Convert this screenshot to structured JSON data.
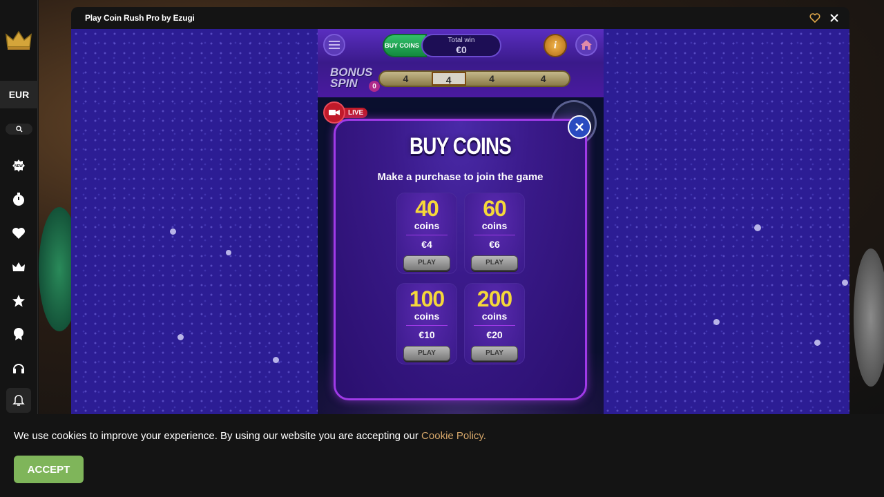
{
  "sidebar": {
    "currency": "EUR",
    "icons": [
      "new-icon",
      "clock-icon",
      "heart-icon",
      "crown-icon",
      "star-icon",
      "award-icon",
      "headset-icon",
      "bell-icon"
    ]
  },
  "game_window": {
    "title": "Play Coin Rush Pro by Ezugi"
  },
  "game": {
    "buy_coins_label": "BUY COINS",
    "total_win_label": "Total win",
    "total_win_value": "€0",
    "info_label": "i",
    "bonus_label": "BONUS SPIN",
    "bonus_count": "0",
    "bonus_cells": [
      "4",
      "4",
      "4",
      "4"
    ],
    "live_label": "LIVE"
  },
  "modal": {
    "title": "BUY COINS",
    "subtitle": "Make a purchase to join the game",
    "offers": [
      {
        "amount": "40",
        "unit": "coins",
        "price": "€4",
        "button": "PLAY"
      },
      {
        "amount": "60",
        "unit": "coins",
        "price": "€6",
        "button": "PLAY"
      },
      {
        "amount": "100",
        "unit": "coins",
        "price": "€10",
        "button": "PLAY"
      },
      {
        "amount": "200",
        "unit": "coins",
        "price": "€20",
        "button": "PLAY"
      }
    ]
  },
  "cookie": {
    "text": "We use cookies to improve your experience. By using our website you are accepting our ",
    "link": "Cookie Policy.",
    "accept": "ACCEPT"
  },
  "colors": {
    "accent_purple": "#a03ae8",
    "coin_yellow": "#f5d73a",
    "accept_green": "#7fb55a",
    "link_gold": "#d6a76a"
  }
}
